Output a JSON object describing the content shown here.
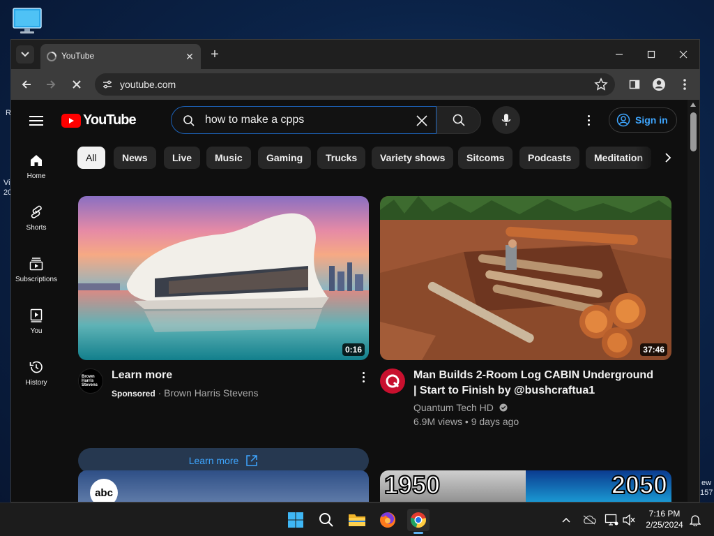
{
  "desktop": {
    "edge_text_left": [
      "R",
      "Vi",
      "20"
    ],
    "edge_text_right": [
      "ew",
      "157"
    ]
  },
  "browser": {
    "tab_title": "YouTube",
    "address": "youtube.com"
  },
  "youtube": {
    "logo_text": "YouTube",
    "search_value": "how to make a cpps",
    "sign_in": "Sign in",
    "guide": [
      {
        "label": "Home",
        "icon": "home-icon"
      },
      {
        "label": "Shorts",
        "icon": "shorts-icon"
      },
      {
        "label": "Subscriptions",
        "icon": "subscriptions-icon"
      },
      {
        "label": "You",
        "icon": "you-icon"
      },
      {
        "label": "History",
        "icon": "history-icon"
      }
    ],
    "chips": [
      "All",
      "News",
      "Live",
      "Music",
      "Gaming",
      "Trucks",
      "Variety shows",
      "Sitcoms",
      "Podcasts",
      "Meditation"
    ],
    "videos": [
      {
        "title": "Learn more",
        "duration": "0:16",
        "sponsored": "Sponsored",
        "channel": "Brown Harris Stevens",
        "avatar_text": "Brown Harris Stevens",
        "cta": "Learn more"
      },
      {
        "title": "Man Builds 2-Room Log CABIN Underground | Start to Finish by @bushcraftua1",
        "duration": "37:46",
        "channel": "Quantum Tech HD",
        "views": "6.9M views",
        "age": "9 days ago"
      },
      {
        "badge": "abc"
      },
      {
        "left_year": "1950",
        "right_year": "2050"
      }
    ]
  },
  "taskbar": {
    "time": "7:16 PM",
    "date": "2/25/2024"
  },
  "colors": {
    "youtube_red": "#ff0000",
    "link_blue": "#3ea6ff",
    "page_bg": "#0f0f0f"
  }
}
